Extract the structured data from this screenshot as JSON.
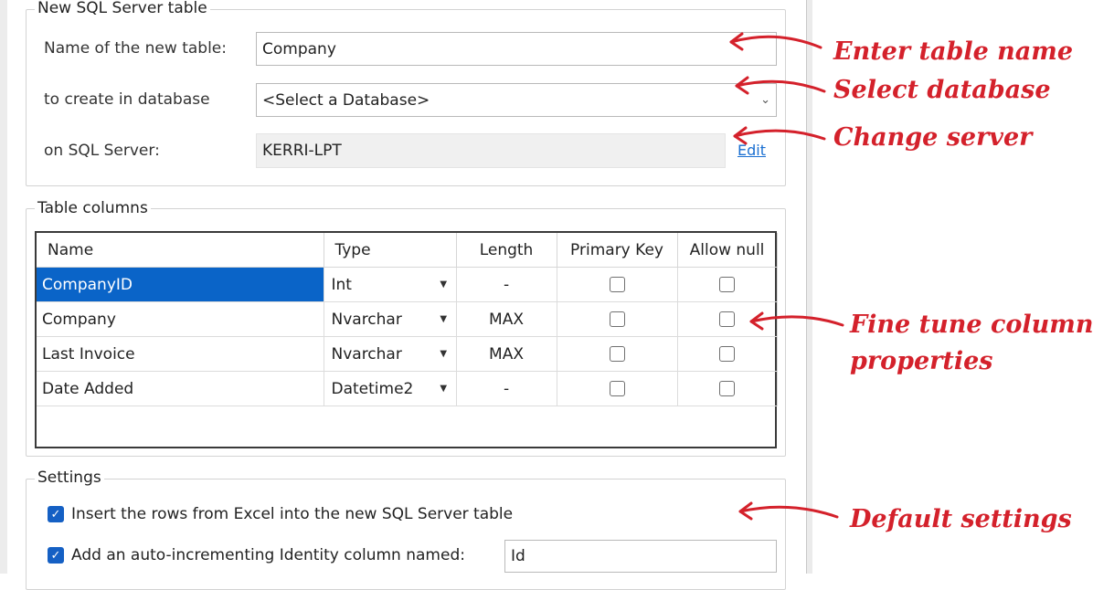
{
  "new_table_group": {
    "title": "New SQL Server table",
    "name_label": "Name of the new table:",
    "name_value": "Company",
    "database_label": "to create in database",
    "database_value": "<Select a Database>",
    "server_label": "on SQL Server:",
    "server_value": "KERRI-LPT",
    "edit_link": "Edit"
  },
  "columns_group": {
    "title": "Table columns",
    "headers": [
      "Name",
      "Type",
      "Length",
      "Primary Key",
      "Allow null"
    ],
    "rows": [
      {
        "name": "CompanyID",
        "type": "Int",
        "length": "-",
        "selected": true
      },
      {
        "name": "Company",
        "type": "Nvarchar",
        "length": "MAX",
        "selected": false
      },
      {
        "name": "Last Invoice",
        "type": "Nvarchar",
        "length": "MAX",
        "selected": false
      },
      {
        "name": "Date Added",
        "type": "Datetime2",
        "length": "-",
        "selected": false
      }
    ]
  },
  "settings_group": {
    "title": "Settings",
    "insert_rows_label": "Insert the rows from Excel into the new SQL Server table",
    "insert_rows_checked": true,
    "identity_label": "Add an auto-incrementing Identity column named:",
    "identity_checked": true,
    "identity_value": "Id"
  },
  "annotations": {
    "enter_table_name": "Enter table name",
    "select_database": "Select database",
    "change_server": "Change server",
    "fine_tune_line1": "Fine tune column",
    "fine_tune_line2": "properties",
    "default_settings": "Default settings"
  },
  "icons": {
    "dropdown": "chevron-down-icon",
    "type_dropdown": "small-triangle-down-icon",
    "checkbox_checked": "check-icon",
    "arrow": "curved-arrow-left-icon"
  },
  "colors": {
    "annotation_red": "#d4212b",
    "selection_blue": "#0a64c8",
    "checkbox_blue": "#1560c4",
    "link_blue": "#1a6fd1"
  }
}
